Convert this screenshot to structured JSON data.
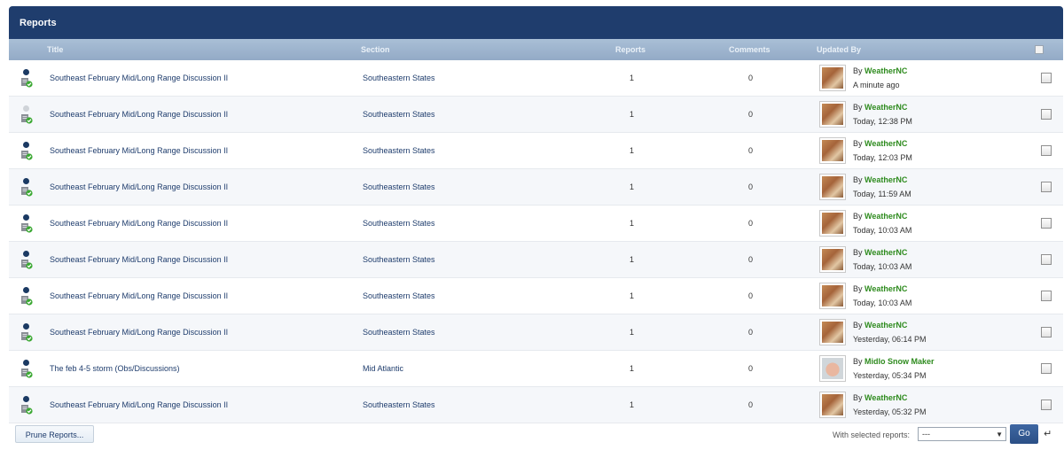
{
  "panel": {
    "title": "Reports"
  },
  "columns": {
    "title": "Title",
    "section": "Section",
    "reports": "Reports",
    "comments": "Comments",
    "updated_by": "Updated By"
  },
  "rows": [
    {
      "read": false,
      "title": "Southeast February Mid/Long Range Discussion II",
      "section": "Southeastern States",
      "reports": "1",
      "comments": "0",
      "by_prefix": "By",
      "user": "WeatherNC",
      "time": "A minute ago",
      "avatar": "weathernc-avatar"
    },
    {
      "read": true,
      "title": "Southeast February Mid/Long Range Discussion II",
      "section": "Southeastern States",
      "reports": "1",
      "comments": "0",
      "by_prefix": "By",
      "user": "WeatherNC",
      "time": "Today, 12:38 PM",
      "avatar": "weathernc-avatar"
    },
    {
      "read": false,
      "title": "Southeast February Mid/Long Range Discussion II",
      "section": "Southeastern States",
      "reports": "1",
      "comments": "0",
      "by_prefix": "By",
      "user": "WeatherNC",
      "time": "Today, 12:03 PM",
      "avatar": "weathernc-avatar"
    },
    {
      "read": false,
      "title": "Southeast February Mid/Long Range Discussion II",
      "section": "Southeastern States",
      "reports": "1",
      "comments": "0",
      "by_prefix": "By",
      "user": "WeatherNC",
      "time": "Today, 11:59 AM",
      "avatar": "weathernc-avatar"
    },
    {
      "read": false,
      "title": "Southeast February Mid/Long Range Discussion II",
      "section": "Southeastern States",
      "reports": "1",
      "comments": "0",
      "by_prefix": "By",
      "user": "WeatherNC",
      "time": "Today, 10:03 AM",
      "avatar": "weathernc-avatar"
    },
    {
      "read": false,
      "title": "Southeast February Mid/Long Range Discussion II",
      "section": "Southeastern States",
      "reports": "1",
      "comments": "0",
      "by_prefix": "By",
      "user": "WeatherNC",
      "time": "Today, 10:03 AM",
      "avatar": "weathernc-avatar"
    },
    {
      "read": false,
      "title": "Southeast February Mid/Long Range Discussion II",
      "section": "Southeastern States",
      "reports": "1",
      "comments": "0",
      "by_prefix": "By",
      "user": "WeatherNC",
      "time": "Today, 10:03 AM",
      "avatar": "weathernc-avatar"
    },
    {
      "read": false,
      "title": "Southeast February Mid/Long Range Discussion II",
      "section": "Southeastern States",
      "reports": "1",
      "comments": "0",
      "by_prefix": "By",
      "user": "WeatherNC",
      "time": "Yesterday, 06:14 PM",
      "avatar": "weathernc-avatar"
    },
    {
      "read": false,
      "title": "The feb 4-5 storm (Obs/Discussions)",
      "section": "Mid Atlantic",
      "reports": "1",
      "comments": "0",
      "by_prefix": "By",
      "user": "Midlo Snow Maker",
      "time": "Yesterday, 05:34 PM",
      "avatar": "midlo-avatar"
    },
    {
      "read": false,
      "title": "Southeast February Mid/Long Range Discussion II",
      "section": "Southeastern States",
      "reports": "1",
      "comments": "0",
      "by_prefix": "By",
      "user": "WeatherNC",
      "time": "Yesterday, 05:32 PM",
      "avatar": "weathernc-avatar"
    }
  ],
  "footer": {
    "prune_label": "Prune Reports...",
    "with_selected_label": "With selected reports:",
    "select_value": "---",
    "go_label": "Go"
  },
  "icons": {
    "unread_dot": "unread-dot-icon",
    "report": "report-icon",
    "checkbox": "checkbox-icon",
    "dropdown": "chevron-down-icon",
    "arrow": "return-arrow-icon"
  },
  "colors": {
    "titlebar": "#1f3d6d",
    "header": "#9fb5cf",
    "link": "#1f3d6d",
    "username": "#2e8b1e",
    "go_button": "#335a92"
  }
}
